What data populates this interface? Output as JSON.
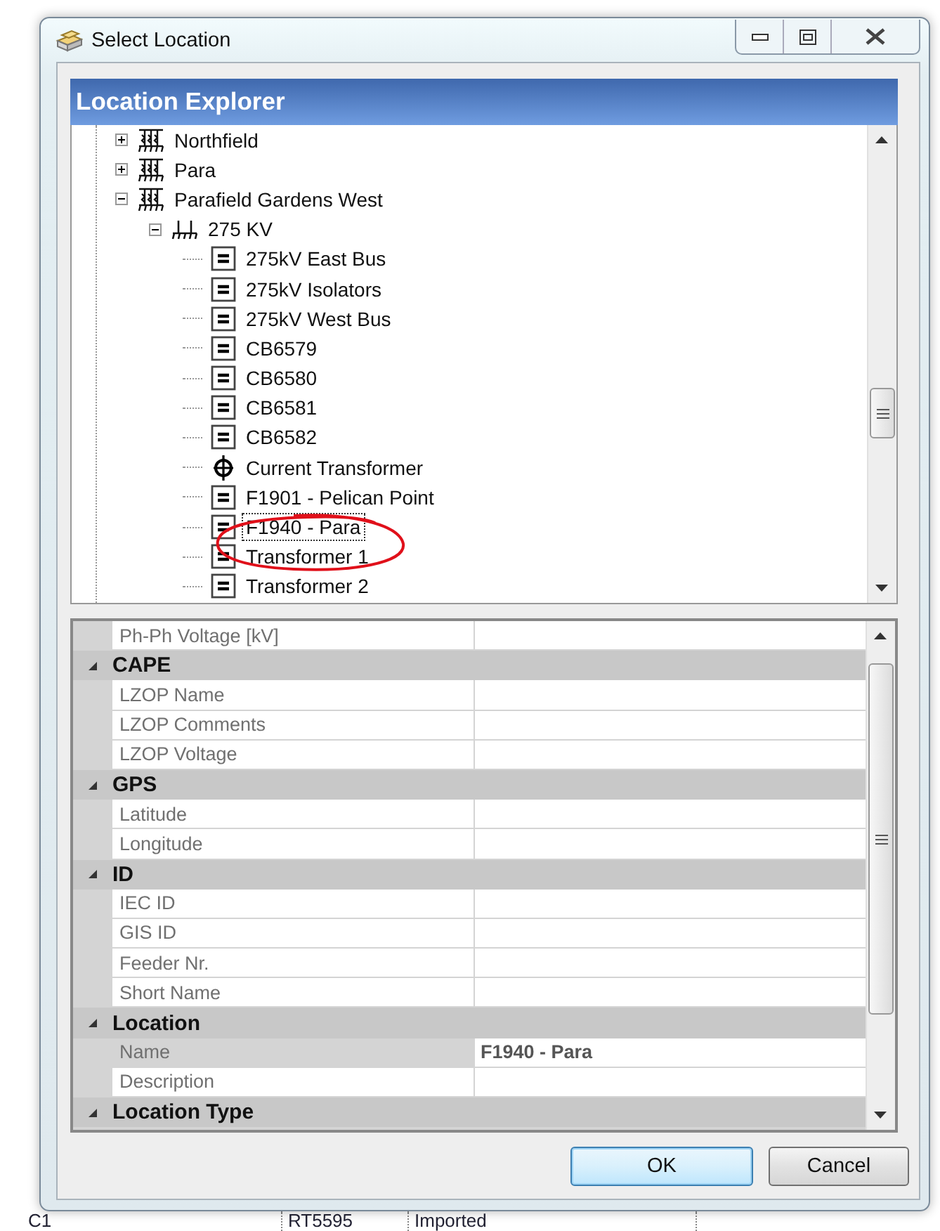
{
  "background_table": {
    "cells": [
      "C1",
      "RT5595",
      "Imported"
    ]
  },
  "window": {
    "title": "Select Location"
  },
  "header": {
    "title": "Location Explorer"
  },
  "tree": {
    "items": [
      {
        "label": "Northfield",
        "kind": "substation",
        "expanded": false,
        "selected": false
      },
      {
        "label": "Para",
        "kind": "substation",
        "expanded": false,
        "selected": false
      },
      {
        "label": "Parafield Gardens West",
        "kind": "substation",
        "expanded": true,
        "selected": false,
        "children": [
          {
            "label": "275 KV",
            "kind": "voltage",
            "expanded": true,
            "selected": false,
            "children": [
              {
                "label": "275kV East Bus",
                "kind": "equipment",
                "selected": false
              },
              {
                "label": "275kV Isolators",
                "kind": "equipment",
                "selected": false
              },
              {
                "label": "275kV West Bus",
                "kind": "equipment",
                "selected": false
              },
              {
                "label": "CB6579",
                "kind": "equipment",
                "selected": false
              },
              {
                "label": "CB6580",
                "kind": "equipment",
                "selected": false
              },
              {
                "label": "CB6581",
                "kind": "equipment",
                "selected": false
              },
              {
                "label": "CB6582",
                "kind": "equipment",
                "selected": false
              },
              {
                "label": "Current Transformer",
                "kind": "current_transformer",
                "selected": false
              },
              {
                "label": "F1901 - Pelican Point",
                "kind": "equipment",
                "selected": false
              },
              {
                "label": "F1940 - Para",
                "kind": "equipment",
                "selected": true
              },
              {
                "label": "Transformer 1",
                "kind": "equipment",
                "selected": false
              },
              {
                "label": "Transformer 2",
                "kind": "equipment",
                "selected": false
              }
            ]
          }
        ]
      }
    ]
  },
  "property_grid": {
    "rows": [
      {
        "kind": "property",
        "label": "Ph-Ph Voltage [kV]",
        "selected": false
      },
      {
        "kind": "category",
        "label": "CAPE",
        "expanded": true
      },
      {
        "kind": "property",
        "label": "LZOP Name",
        "selected": false
      },
      {
        "kind": "property",
        "label": "LZOP Comments",
        "selected": false
      },
      {
        "kind": "property",
        "label": "LZOP Voltage",
        "selected": false
      },
      {
        "kind": "category",
        "label": "GPS",
        "expanded": true
      },
      {
        "kind": "property",
        "label": "Latitude",
        "selected": false
      },
      {
        "kind": "property",
        "label": "Longitude",
        "selected": false
      },
      {
        "kind": "category",
        "label": "ID",
        "expanded": true
      },
      {
        "kind": "property",
        "label": "IEC ID",
        "selected": false
      },
      {
        "kind": "property",
        "label": "GIS ID",
        "selected": false
      },
      {
        "kind": "property",
        "label": "Feeder Nr.",
        "selected": false
      },
      {
        "kind": "property",
        "label": "Short Name",
        "selected": false
      },
      {
        "kind": "category",
        "label": "Location",
        "expanded": true
      },
      {
        "kind": "property",
        "label": "Name",
        "value": "F1940 - Para",
        "selected": true
      },
      {
        "kind": "property",
        "label": "Description",
        "selected": false
      },
      {
        "kind": "category",
        "label": "Location Type",
        "expanded": true
      }
    ]
  },
  "buttons": [
    {
      "label": "OK",
      "default": true
    },
    {
      "label": "Cancel",
      "default": false
    }
  ]
}
